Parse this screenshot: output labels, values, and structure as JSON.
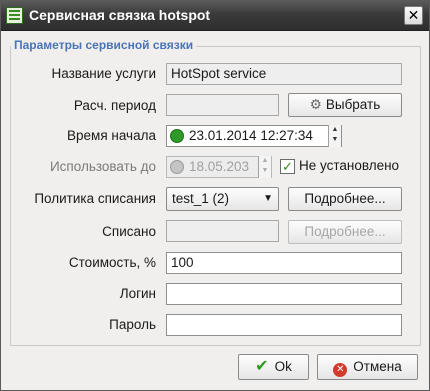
{
  "window": {
    "title": "Сервисная связка hotspot",
    "close_glyph": "✕"
  },
  "group": {
    "title": "Параметры сервисной связки"
  },
  "form": {
    "service_name": {
      "label": "Название услуги",
      "value": "HotSpot service"
    },
    "billing_period": {
      "label": "Расч. период",
      "value": "",
      "button_label": "Выбрать"
    },
    "start_time": {
      "label": "Время начала",
      "value": "23.01.2014 12:27:34"
    },
    "use_until": {
      "label": "Использовать до",
      "value": "18.05.203",
      "checkbox_label": "Не установлено",
      "checked": true
    },
    "charge_policy": {
      "label": "Политика списания",
      "selected": "test_1 (2)",
      "button_label": "Подробнее..."
    },
    "charged": {
      "label": "Списано",
      "value": "",
      "button_label": "Подробнее..."
    },
    "cost": {
      "label": "Стоимость, %",
      "value": "100"
    },
    "login": {
      "label": "Логин",
      "value": ""
    },
    "password": {
      "label": "Пароль",
      "value": ""
    }
  },
  "footer": {
    "ok_label": "Ok",
    "cancel_label": "Отмена"
  },
  "icons": {
    "app": "service-bundle-icon",
    "select": "gear-icon",
    "start_time": "green-clock-icon",
    "use_until": "grey-clock-icon",
    "dropdown": "chevron-down-icon",
    "ok": "checkmark-icon",
    "cancel": "cancel-icon"
  },
  "colors": {
    "titlebar": "#3a3a3a",
    "group_title": "#4a74b8",
    "ok_check": "#2c9a1f",
    "cancel": "#d13b2b"
  }
}
